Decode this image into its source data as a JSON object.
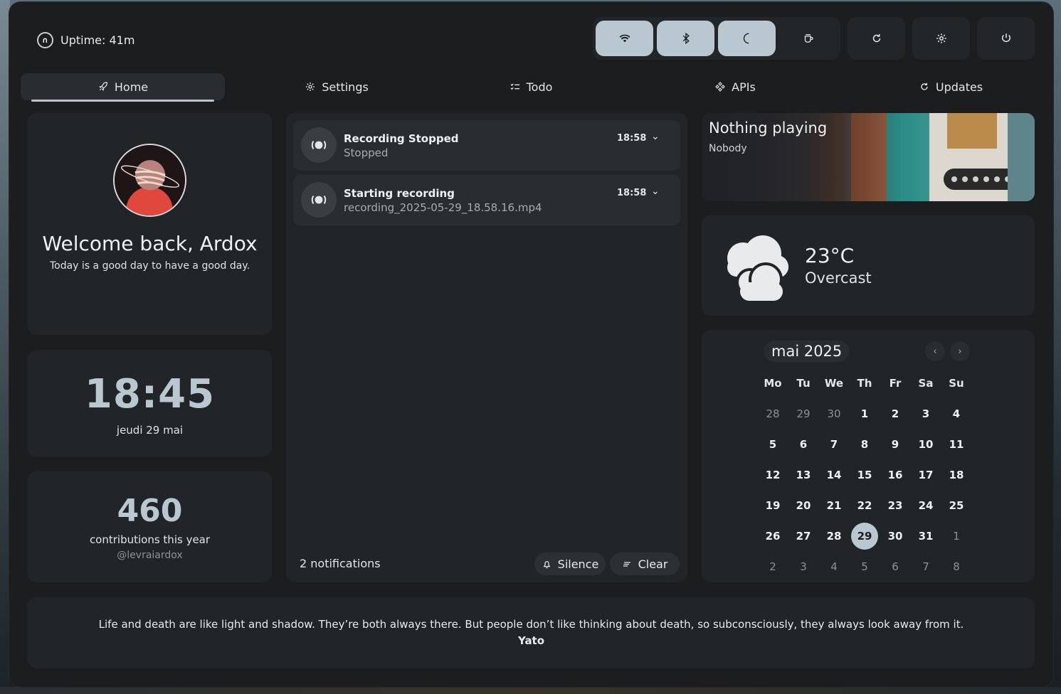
{
  "topbar": {
    "uptime": "Uptime: 41m",
    "logo_glyph": "∩",
    "toggles": [
      {
        "name": "wifi-icon",
        "active": true
      },
      {
        "name": "bluetooth-icon",
        "active": true
      },
      {
        "name": "moon-icon",
        "active": true
      },
      {
        "name": "coffee-icon",
        "active": false
      }
    ],
    "actions": [
      "refresh-icon",
      "settings-icon",
      "power-icon"
    ]
  },
  "tabs": [
    {
      "label": "Home",
      "icon": "rocket-icon"
    },
    {
      "label": "Settings",
      "icon": "gear-icon"
    },
    {
      "label": "Todo",
      "icon": "checklist-icon"
    },
    {
      "label": "APIs",
      "icon": "api-icon"
    },
    {
      "label": "Updates",
      "icon": "refresh-icon"
    }
  ],
  "profile": {
    "welcome": "Welcome back, Ardox",
    "subtitle": "Today is a good day to have a good day."
  },
  "clock": {
    "time": "18:45",
    "date": "jeudi 29 mai"
  },
  "contributions": {
    "count": "460",
    "label": "contributions this year",
    "user": "@levraiardox"
  },
  "notifications": {
    "items": [
      {
        "title": "Recording Stopped",
        "body": "Stopped",
        "time": "18:58"
      },
      {
        "title": "Starting recording",
        "body": "recording_2025-05-29_18.58.16.mp4",
        "time": "18:58"
      }
    ],
    "count_label": "2 notifications",
    "silence_label": "Silence",
    "clear_label": "Clear"
  },
  "media": {
    "title": "Nothing playing",
    "artist": "Nobody"
  },
  "weather": {
    "temp": "23°C",
    "condition": "Overcast"
  },
  "calendar": {
    "month": "mai 2025",
    "weekdays": [
      "Mo",
      "Tu",
      "We",
      "Th",
      "Fr",
      "Sa",
      "Su"
    ],
    "weeks": [
      [
        [
          "28",
          0
        ],
        [
          "29",
          0
        ],
        [
          "30",
          0
        ],
        [
          "1",
          1
        ],
        [
          "2",
          1
        ],
        [
          "3",
          1
        ],
        [
          "4",
          1
        ]
      ],
      [
        [
          "5",
          1
        ],
        [
          "6",
          1
        ],
        [
          "7",
          1
        ],
        [
          "8",
          1
        ],
        [
          "9",
          1
        ],
        [
          "10",
          1
        ],
        [
          "11",
          1
        ]
      ],
      [
        [
          "12",
          1
        ],
        [
          "13",
          1
        ],
        [
          "14",
          1
        ],
        [
          "15",
          1
        ],
        [
          "16",
          1
        ],
        [
          "17",
          1
        ],
        [
          "18",
          1
        ]
      ],
      [
        [
          "19",
          1
        ],
        [
          "20",
          1
        ],
        [
          "21",
          1
        ],
        [
          "22",
          1
        ],
        [
          "23",
          1
        ],
        [
          "24",
          1
        ],
        [
          "25",
          1
        ]
      ],
      [
        [
          "26",
          1
        ],
        [
          "27",
          1
        ],
        [
          "28",
          1
        ],
        [
          "29",
          2
        ],
        [
          "30",
          1
        ],
        [
          "31",
          1
        ],
        [
          "1",
          0
        ]
      ],
      [
        [
          "2",
          0
        ],
        [
          "3",
          0
        ],
        [
          "4",
          0
        ],
        [
          "5",
          0
        ],
        [
          "6",
          0
        ],
        [
          "7",
          0
        ],
        [
          "8",
          0
        ]
      ]
    ]
  },
  "quote": {
    "text": "Life and death are like light and shadow. They’re both always there. But people don’t like thinking about death, so subconsciously, they always look away from it.",
    "author": "Yato"
  },
  "colors": {
    "panel": "#1b1d1f",
    "card": "#222528",
    "accent": "#b9c8d0"
  }
}
